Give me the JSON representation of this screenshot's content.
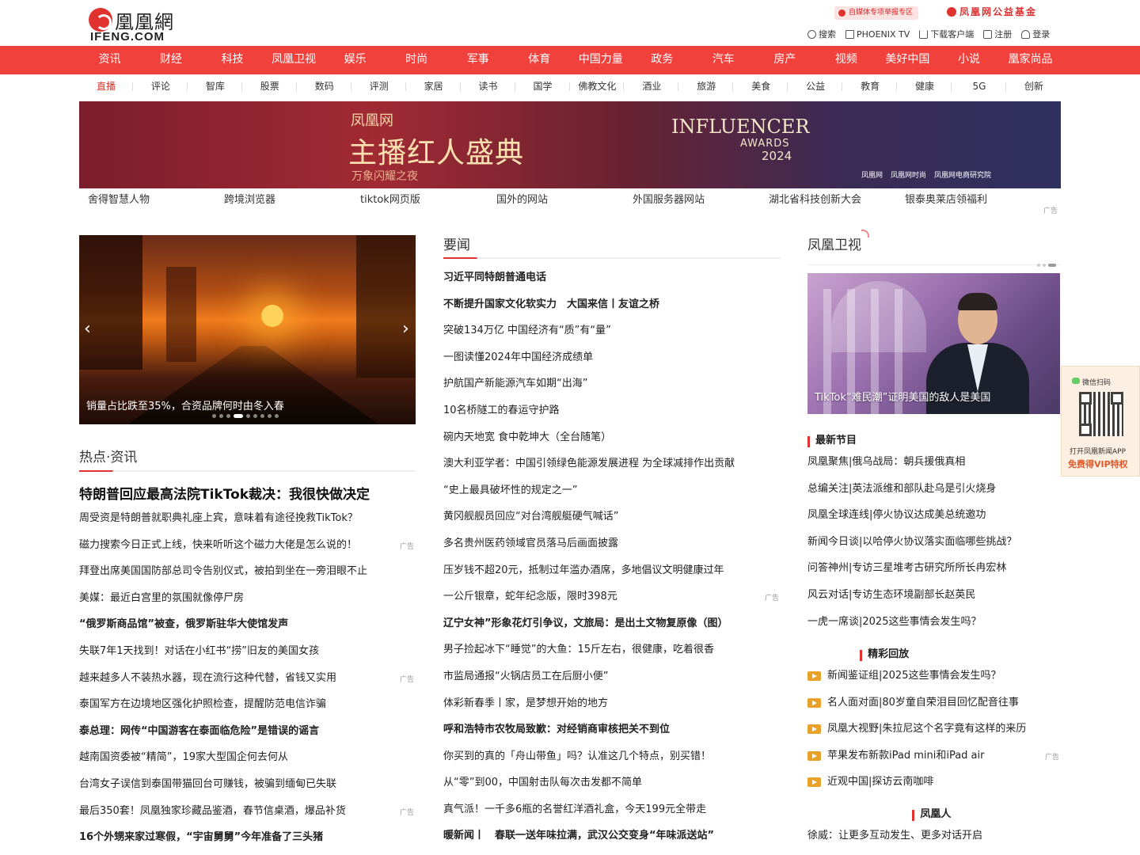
{
  "header": {
    "logo_cn": "凰凰網",
    "logo_en": "IFENG.COM",
    "report_badge": "自媒体专项举报专区",
    "fund": "凤凰网公益基金",
    "links": [
      {
        "icon": "search-icon",
        "label": "搜索"
      },
      {
        "icon": "tv-icon",
        "label": "PHOENIX TV"
      },
      {
        "icon": "download-icon",
        "label": "下载客户端"
      },
      {
        "icon": "register-icon",
        "label": "注册"
      },
      {
        "icon": "user-icon",
        "label": "登录"
      }
    ]
  },
  "main_nav": [
    "资讯",
    "财经",
    "科技",
    "凤凰卫视",
    "娱乐",
    "时尚",
    "军事",
    "体育",
    "中国力量",
    "政务",
    "汽车",
    "房产",
    "视频",
    "美好中国",
    "小说",
    "凰家尚品"
  ],
  "sub_nav": [
    "直播",
    "评论",
    "智库",
    "股票",
    "数码",
    "评测",
    "家居",
    "读书",
    "国学",
    "佛教文化",
    "酒业",
    "旅游",
    "美食",
    "公益",
    "教育",
    "健康",
    "5G",
    "创新"
  ],
  "banner": {
    "brand": "凤凰网",
    "title": "主播红人盛典",
    "subtitle": "万象闪耀之夜",
    "en_title": "INFLUENCER",
    "en_sub": "AWARDS",
    "year": "2024",
    "sponsors": [
      "凤凰网",
      "凤凰网时尚",
      "凤凰网电商研究院"
    ]
  },
  "ad_links": [
    "舍得智慧人物",
    "跨境浏览器",
    "tiktok网页版",
    "国外的网站",
    "外国服务器网站",
    "湖北省科技创新大会",
    "银泰奥莱店领福利"
  ],
  "ad_tag": "广告",
  "slider": {
    "caption": "销量占比跌至35%，合资品牌何时由冬入春",
    "prev": "‹",
    "next": "›"
  },
  "hot": {
    "title": "热点·资讯",
    "headline": "特朗普回应最高法院TikTok裁决：我很快做决定",
    "items": [
      {
        "text": "周受资是特朗普就职典礼座上宾，意味着有途径挽救TikTok？",
        "bold": false,
        "ad": false
      },
      {
        "text": "磁力搜索今日正式上线，快来听听这个磁力大佬是怎么说的！",
        "bold": false,
        "ad": true
      },
      {
        "text": "拜登出席美国国防部总司令告别仪式，被拍到坐在一旁泪眼不止",
        "bold": false,
        "ad": false
      },
      {
        "text": "美媒：最近白宫里的氛围就像停尸房",
        "bold": false,
        "ad": false
      },
      {
        "text": "“俄罗斯商品馆”被查，俄罗斯驻华大使馆发声",
        "bold": true,
        "ad": false
      },
      {
        "text": "失联7年1天找到！对话在小红书“捞”旧友的美国女孩",
        "bold": false,
        "ad": false
      },
      {
        "text": "越来越多人不装热水器，现在流行这种代替，省钱又实用",
        "bold": false,
        "ad": true
      },
      {
        "text": "泰国军方在边境地区强化护照检查，提醒防范电信诈骗",
        "bold": false,
        "ad": false
      },
      {
        "text": "泰总理：网传“中国游客在泰面临危险”是错误的谣言",
        "bold": true,
        "ad": false
      },
      {
        "text": "越南国资委被“精简”，19家大型国企何去何从",
        "bold": false,
        "ad": false
      },
      {
        "text": "台湾女子误信到泰国带猫回台可赚钱，被骗到缅甸已失联",
        "bold": false,
        "ad": false
      },
      {
        "text": "最后350套！凤凰独家珍藏品鉴酒，春节信桌酒，爆品补货",
        "bold": false,
        "ad": true
      },
      {
        "text": "16个外甥来家过寒假，“宇宙舅舅”今年准备了三头猪",
        "bold": true,
        "ad": false
      }
    ]
  },
  "yaowen": {
    "title": "要闻",
    "items": [
      {
        "text": "习近平同特朗普通电话",
        "bold": true,
        "ad": false
      },
      {
        "text": "不断提升国家文化软实力　大国来信丨友谊之桥",
        "bold": true,
        "ad": false
      },
      {
        "text": "突破134万亿 中国经济有“质”有“量”",
        "bold": false,
        "ad": false
      },
      {
        "text": "一图读懂2024年中国经济成绩单",
        "bold": false,
        "ad": false
      },
      {
        "text": "护航国产新能源汽车如期“出海”",
        "bold": false,
        "ad": false
      },
      {
        "text": "10名桥隧工的春运守护路",
        "bold": false,
        "ad": false
      },
      {
        "text": "碗内天地宽 食中乾坤大（全台随笔）",
        "bold": false,
        "ad": false
      },
      {
        "text": "澳大利亚学者：中国引领绿色能源发展进程 为全球减排作出贡献",
        "bold": false,
        "ad": false
      },
      {
        "text": "“史上最具破坏性的规定之一”",
        "bold": false,
        "ad": false
      },
      {
        "text": "黄冈舰舰员回应“对台湾舰艇硬气喊话”",
        "bold": false,
        "ad": false
      },
      {
        "text": "多名贵州医药领域官员落马后画面披露",
        "bold": false,
        "ad": false
      },
      {
        "text": "压岁钱不超20元，抵制过年滥办酒席，多地倡议文明健康过年",
        "bold": false,
        "ad": false
      },
      {
        "text": "一公斤银章，蛇年纪念版，限时398元",
        "bold": false,
        "ad": true
      },
      {
        "text": "辽宁女神”形象花灯引争议，文旅局：是出土文物复原像（图）",
        "bold": true,
        "ad": false
      },
      {
        "text": "男子捡起冰下“睡觉”的大鱼：15斤左右，很健康，吃着很香",
        "bold": false,
        "ad": false
      },
      {
        "text": "市监局通报“火锅店员工在后厨小便”",
        "bold": false,
        "ad": false
      },
      {
        "text": "体彩新春季丨家，是梦想开始的地方",
        "bold": false,
        "ad": false
      },
      {
        "text": "呼和浩特市农牧局致歉：对经销商审核把关不到位",
        "bold": true,
        "ad": false
      },
      {
        "text": "你买到的真的「舟山带鱼」吗？认准这几个特点，别买错！",
        "bold": false,
        "ad": false
      },
      {
        "text": "从“零”到00，中国射击队每次击发都不简单",
        "bold": false,
        "ad": false
      },
      {
        "text": "真气派！一千多6瓶的名誉红洋酒礼盒，今天199元全带走",
        "bold": false,
        "ad": false
      },
      {
        "text": "暖新闻丨　春联一送年味拉满，武汉公交变身“年味派送站”",
        "bold": true,
        "ad": false
      }
    ]
  },
  "tv": {
    "title": "凤凰卫视",
    "caption": "TikTok“难民潮”证明美国的敌人是美国",
    "latest_head": "最新节目",
    "latest": [
      "凤凰聚焦|俄乌战局：朝兵援俄真相",
      "总编关注|英法派维和部队赴乌是引火烧身",
      "凤凰全球连线|停火协议达成美总统邀功",
      "新闻今日谈|以哈停火协议落实面临哪些挑战？",
      "问答神州|专访三星堆考古研究所所长冉宏林",
      "风云对话|专访生态环境副部长赵英民",
      "一虎一席谈|2025这些事情会发生吗？"
    ],
    "replay_head": "精彩回放",
    "replay": [
      {
        "text": "新闻鉴证组|2025这些事情会发生吗？",
        "ad": false
      },
      {
        "text": "名人面对面|80岁童自荣泪目回忆配音往事",
        "ad": false
      },
      {
        "text": "凤凰大视野|朱拉尼这个名字竟有这样的来历",
        "ad": false
      },
      {
        "text": "苹果发布新款iPad mini和iPad air",
        "ad": true
      },
      {
        "text": "近观中国|探访云南咖啡",
        "ad": false
      }
    ],
    "people_head": "凤凰人",
    "people": [
      "徐威：让更多互动发生、更多对话开启"
    ]
  },
  "qr": {
    "scan": "微信扫码",
    "open": "打开凤凰新闻APP",
    "vip": "免费得VIP特权"
  }
}
